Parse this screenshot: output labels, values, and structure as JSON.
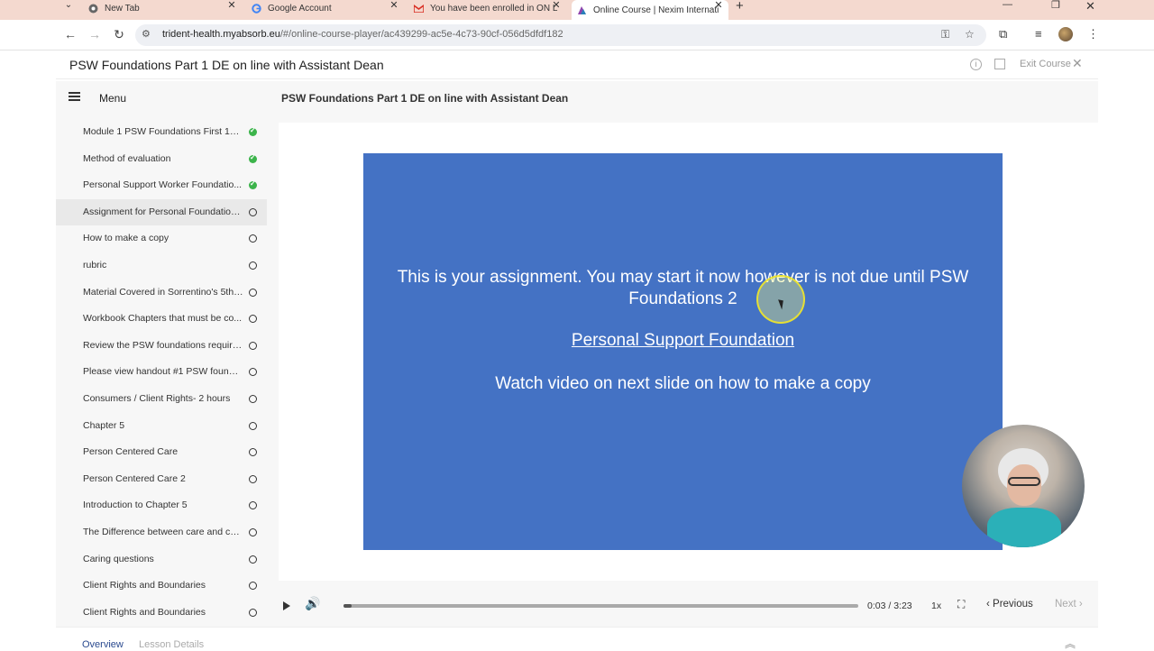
{
  "browser": {
    "tabs": [
      {
        "title": "New Tab",
        "icon": "chrome-icon",
        "active": false
      },
      {
        "title": "Google Account",
        "icon": "google-icon",
        "active": false
      },
      {
        "title": "You have been enrolled in ON L",
        "icon": "gmail-icon",
        "active": false
      },
      {
        "title": "Online Course | Nexim Internati",
        "icon": "absorb-icon",
        "active": true
      }
    ],
    "url_host": "trident-health.myabsorb.eu",
    "url_path": "/#/online-course-player/ac439299-ac5e-4c73-90cf-056d5dfdf182"
  },
  "course": {
    "title": "PSW Foundations Part 1 DE on line with Assistant Dean",
    "exit_label": "Exit Course"
  },
  "menu": {
    "label": "Menu",
    "lessons": [
      {
        "label": "Module 1 PSW Foundations First 18 ...",
        "status": "complete"
      },
      {
        "label": "Method of evaluation",
        "status": "complete"
      },
      {
        "label": "Personal Support Worker Foundatio...",
        "status": "complete"
      },
      {
        "label": "Assignment for Personal Foundation...",
        "status": "incomplete",
        "active": true
      },
      {
        "label": "How to make a copy",
        "status": "incomplete"
      },
      {
        "label": "rubric",
        "status": "incomplete"
      },
      {
        "label": "Material Covered in Sorrentino's 5th ...",
        "status": "incomplete"
      },
      {
        "label": "Workbook Chapters that must be co...",
        "status": "incomplete"
      },
      {
        "label": "Review the PSW foundations require...",
        "status": "incomplete"
      },
      {
        "label": "Please view handout #1 PSW founda...",
        "status": "incomplete"
      },
      {
        "label": "Consumers / Client Rights- 2 hours",
        "status": "incomplete"
      },
      {
        "label": "Chapter 5",
        "status": "incomplete"
      },
      {
        "label": "Person Centered Care",
        "status": "incomplete"
      },
      {
        "label": "Person Centered Care 2",
        "status": "incomplete"
      },
      {
        "label": "Introduction to Chapter 5",
        "status": "incomplete"
      },
      {
        "label": "The Difference between care and car...",
        "status": "incomplete"
      },
      {
        "label": "Caring questions",
        "status": "incomplete"
      },
      {
        "label": "Client Rights and Boundaries",
        "status": "incomplete"
      },
      {
        "label": "Client Rights and Boundaries",
        "status": "incomplete"
      }
    ]
  },
  "content": {
    "title": "PSW Foundations Part 1 DE on line with Assistant Dean",
    "slide": {
      "line1": "This is your assignment.  You may start it now however is not due until PSW Foundations 2",
      "line2": "Personal Support Foundation ",
      "line3": "Watch video on next slide on how to make a copy",
      "background": "#4472c4"
    }
  },
  "player": {
    "time": "0:03 / 3:23",
    "progress_fraction": 0.015,
    "speed": "1x",
    "previous_label": "Previous",
    "next_label": "Next"
  },
  "bottom_tabs": {
    "overview": "Overview",
    "details": "Lesson Details"
  },
  "colors": {
    "accent_link": "#2a4a8f",
    "complete_green": "#3cb44b",
    "tabbar": "#f4d9cf"
  }
}
